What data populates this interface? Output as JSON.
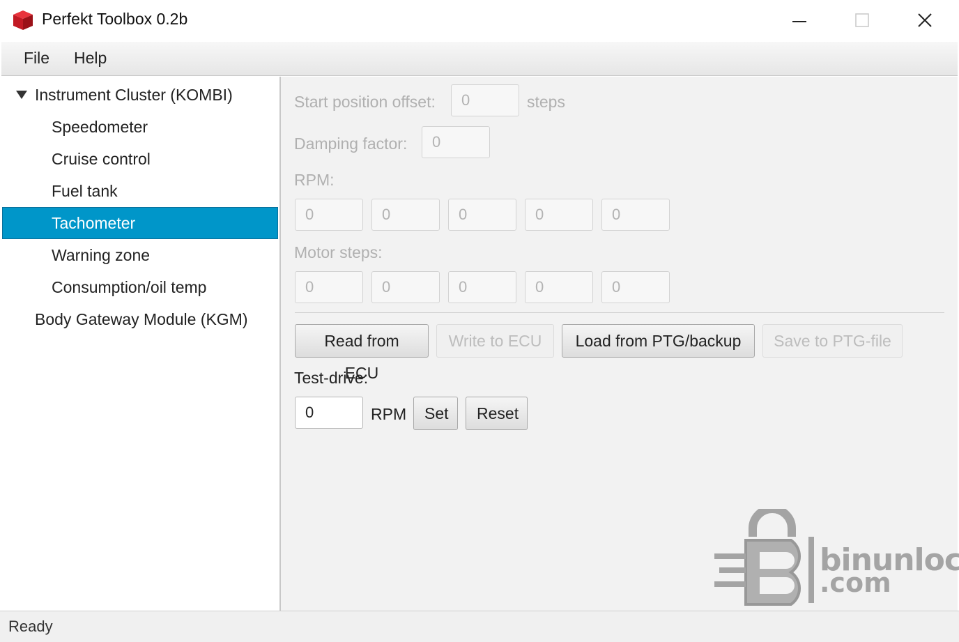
{
  "window": {
    "title": "Perfekt Toolbox 0.2b",
    "icon": "red-cube-icon",
    "controls": [
      "minimize-icon",
      "maximize-icon",
      "close-icon"
    ]
  },
  "menu": {
    "file": "File",
    "help": "Help"
  },
  "tree": {
    "root1": "Instrument Cluster (KOMBI)",
    "children": [
      "Speedometer",
      "Cruise control",
      "Fuel tank",
      "Tachometer",
      "Warning zone",
      "Consumption/oil temp"
    ],
    "selected": "Tachometer",
    "root2": "Body Gateway Module (KGM)"
  },
  "form": {
    "start_offset_label": "Start position offset:",
    "start_offset_value": "0",
    "steps_unit": "steps",
    "damping_label": "Damping factor:",
    "damping_value": "0",
    "rpm_label": "RPM:",
    "rpm_values": [
      "0",
      "0",
      "0",
      "0",
      "0"
    ],
    "motor_steps_label": "Motor steps:",
    "motor_steps_values": [
      "0",
      "0",
      "0",
      "0",
      "0"
    ]
  },
  "actions": {
    "read": "Read from ECU",
    "write": "Write to ECU",
    "load": "Load from PTG/backup",
    "save": "Save to PTG-file"
  },
  "testdrive": {
    "label": "Test-drive:",
    "value": "0",
    "unit": "RPM",
    "set": "Set",
    "reset": "Reset"
  },
  "status": {
    "text": "Ready"
  },
  "watermark": {
    "line1": "binunlock",
    "line2": ".com"
  },
  "colors": {
    "selection": "#0096c9",
    "disabled_text": "#b0b0b0",
    "icon_red": "#d0202a"
  }
}
